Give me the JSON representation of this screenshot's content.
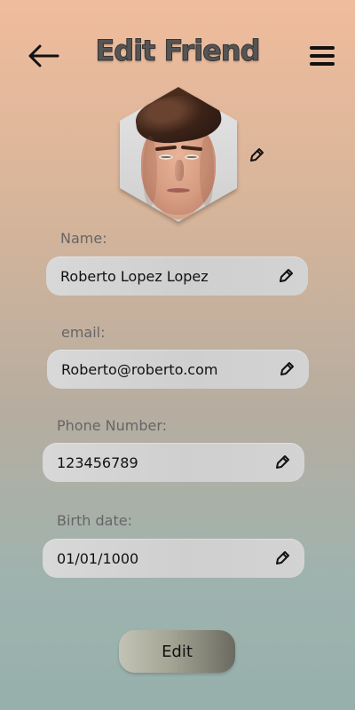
{
  "header": {
    "title": "Edit Friend",
    "back_icon": "arrow-left-icon",
    "menu_icon": "hamburger-menu-icon"
  },
  "profile": {
    "photo_edit_icon": "pencil-icon"
  },
  "form": {
    "fields": [
      {
        "label": "Name:",
        "value": "Roberto Lopez Lopez",
        "icon": "pencil-icon"
      },
      {
        "label": "email:",
        "value": "Roberto@roberto.com",
        "icon": "pencil-icon"
      },
      {
        "label": "Phone Number:",
        "value": "123456789",
        "icon": "pencil-icon"
      },
      {
        "label": "Birth date:",
        "value": "01/01/1000",
        "icon": "pencil-icon"
      }
    ],
    "submit_label": "Edit"
  },
  "colors": {
    "background_top": "#f0bc9d",
    "background_bottom": "#97b0ac",
    "field_background": "#d3d3d3",
    "button_light": "#c2c3b6",
    "button_dark": "#6b6a61"
  }
}
